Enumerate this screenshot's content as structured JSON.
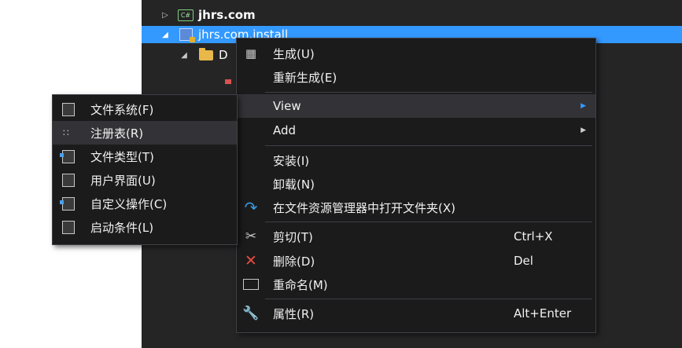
{
  "tree": {
    "rows": [
      {
        "label": "jhrs.com",
        "icon": "csharp-project-icon",
        "expander": "▷"
      },
      {
        "label": "jhrs.com.install",
        "icon": "setup-project-icon",
        "expander": "◢"
      },
      {
        "label": "D",
        "icon": "folder-icon",
        "expander": "◢"
      }
    ],
    "cs_badge": "C#"
  },
  "context_menu": {
    "items": [
      {
        "label": "生成(U)",
        "icon": "build-icon"
      },
      {
        "label": "重新生成(E)",
        "icon": ""
      },
      {
        "label": "View",
        "icon": "",
        "arrow": "▶"
      },
      {
        "label": "Add",
        "icon": "",
        "arrow": "▶"
      },
      {
        "label": "安装(I)",
        "icon": ""
      },
      {
        "label": "卸载(N)",
        "icon": ""
      },
      {
        "label": "在文件资源管理器中打开文件夹(X)",
        "icon": "open-folder-arrow-icon"
      },
      {
        "label": "剪切(T)",
        "shortcut": "Ctrl+X",
        "icon": "scissors-icon"
      },
      {
        "label": "删除(D)",
        "shortcut": "Del",
        "icon": "delete-x-icon"
      },
      {
        "label": "重命名(M)",
        "icon": "rename-icon"
      },
      {
        "label": "属性(R)",
        "shortcut": "Alt+Enter",
        "icon": "wrench-icon"
      }
    ]
  },
  "view_submenu": {
    "items": [
      {
        "label": "文件系统(F)",
        "icon": "file-system-icon"
      },
      {
        "label": "注册表(R)",
        "icon": "registry-icon"
      },
      {
        "label": "文件类型(T)",
        "icon": "file-types-icon"
      },
      {
        "label": "用户界面(U)",
        "icon": "user-interface-icon"
      },
      {
        "label": "自定义操作(C)",
        "icon": "custom-actions-icon"
      },
      {
        "label": "启动条件(L)",
        "icon": "launch-conditions-icon"
      }
    ]
  },
  "colors": {
    "selection": "#3399ff",
    "menu_bg": "#1b1b1c",
    "delete_red": "#e84c3d",
    "open_folder_blue": "#3a9be0"
  }
}
